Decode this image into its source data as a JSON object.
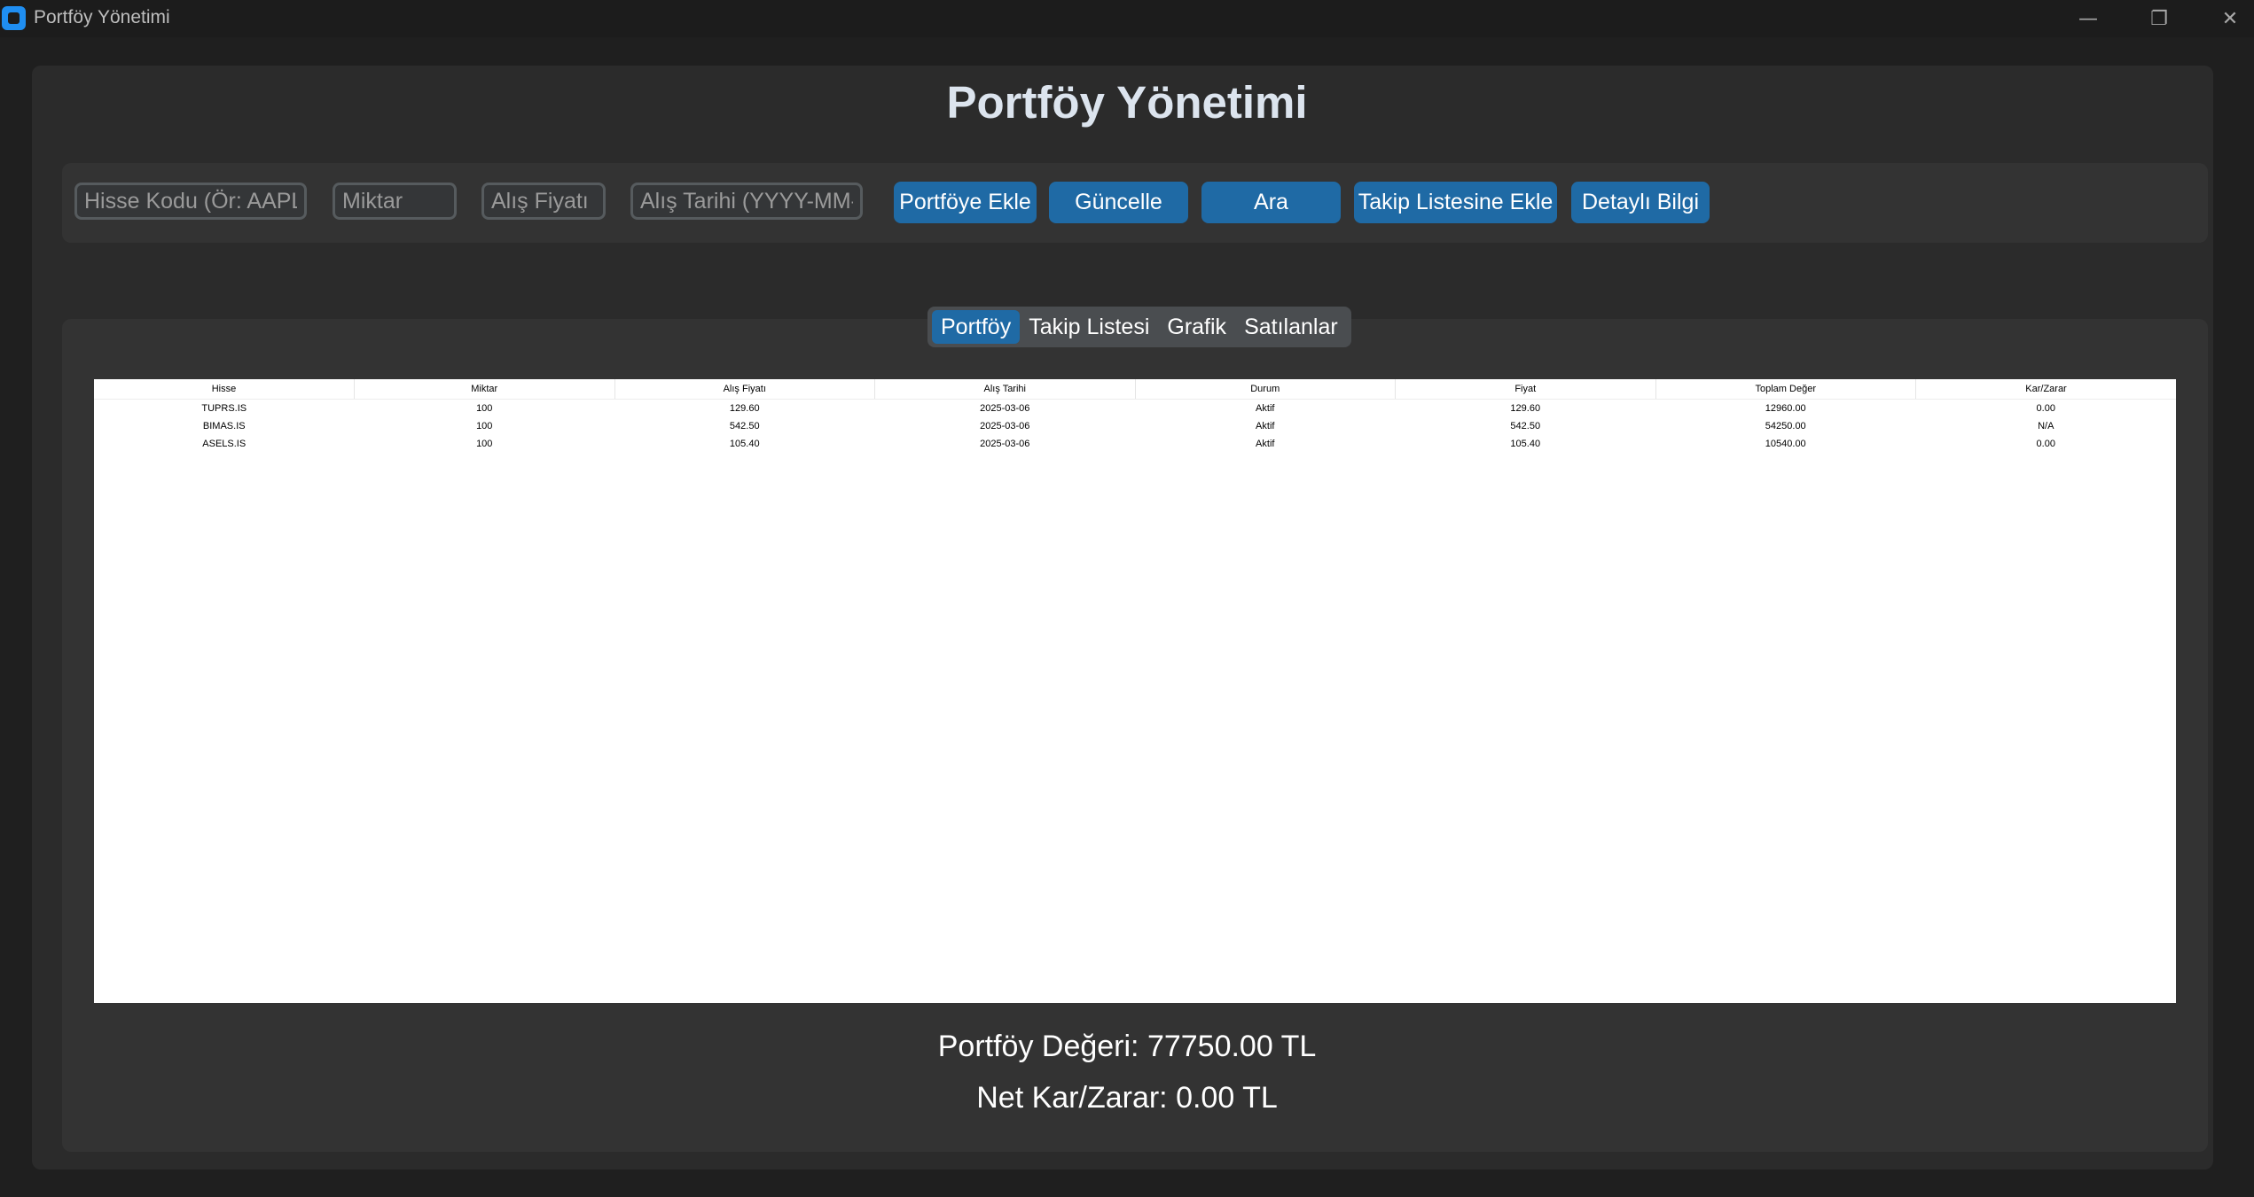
{
  "window": {
    "title": "Portföy Yönetimi",
    "controls": {
      "minimize": "—",
      "maximize": "❐",
      "close": "✕"
    }
  },
  "header": {
    "title": "Portföy Yönetimi"
  },
  "inputs": {
    "stock_code_placeholder": "Hisse Kodu (Ör: AAPL)",
    "quantity_placeholder": "Miktar",
    "buy_price_placeholder": "Alış Fiyatı",
    "buy_date_placeholder": "Alış Tarihi (YYYY-MM-DD)"
  },
  "buttons": {
    "add_to_portfolio": "Portföye Ekle",
    "update": "Güncelle",
    "search": "Ara",
    "add_to_watchlist": "Takip Listesine Ekle",
    "details": "Detaylı Bilgi"
  },
  "tabs": [
    {
      "label": "Portföy",
      "active": true
    },
    {
      "label": "Takip Listesi",
      "active": false
    },
    {
      "label": "Grafik",
      "active": false
    },
    {
      "label": "Satılanlar",
      "active": false
    }
  ],
  "table": {
    "columns": [
      "Hisse",
      "Miktar",
      "Alış Fiyatı",
      "Alış Tarihi",
      "Durum",
      "Fiyat",
      "Toplam Değer",
      "Kar/Zarar"
    ],
    "rows": [
      [
        "TUPRS.IS",
        "100",
        "129.60",
        "2025-03-06",
        "Aktif",
        "129.60",
        "12960.00",
        "0.00"
      ],
      [
        "BIMAS.IS",
        "100",
        "542.50",
        "2025-03-06",
        "Aktif",
        "542.50",
        "54250.00",
        "N/A"
      ],
      [
        "ASELS.IS",
        "100",
        "105.40",
        "2025-03-06",
        "Aktif",
        "105.40",
        "10540.00",
        "0.00"
      ]
    ]
  },
  "summary": {
    "portfolio_value": "Portföy Değeri: 77750.00 TL",
    "net_profit_loss": "Net Kar/Zarar: 0.00 TL"
  },
  "colors": {
    "accent": "#1f6aa5",
    "background": "#2b2b2b",
    "frame": "#333333"
  }
}
